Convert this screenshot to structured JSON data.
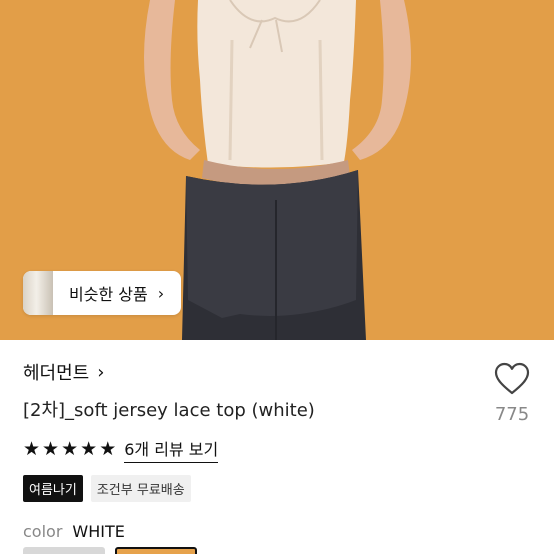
{
  "hero": {
    "background_color": "#e6a24c",
    "similar_products_label": "비슷한 상품",
    "chevron": "›"
  },
  "brand": {
    "name": "헤더먼트",
    "chevron": "›"
  },
  "product": {
    "title": "[2차]_soft jersey lace top (white)"
  },
  "like": {
    "icon": "heart-outline-icon",
    "count": "775"
  },
  "rating": {
    "stars": 5,
    "review_link": "6개 리뷰 보기"
  },
  "tags": [
    {
      "label": "여름나기"
    },
    {
      "label": "조건부 무료배송"
    }
  ],
  "option": {
    "label": "color",
    "value": "WHITE"
  },
  "colors": {
    "accent_dark": "#111111",
    "muted_text": "#888888"
  }
}
